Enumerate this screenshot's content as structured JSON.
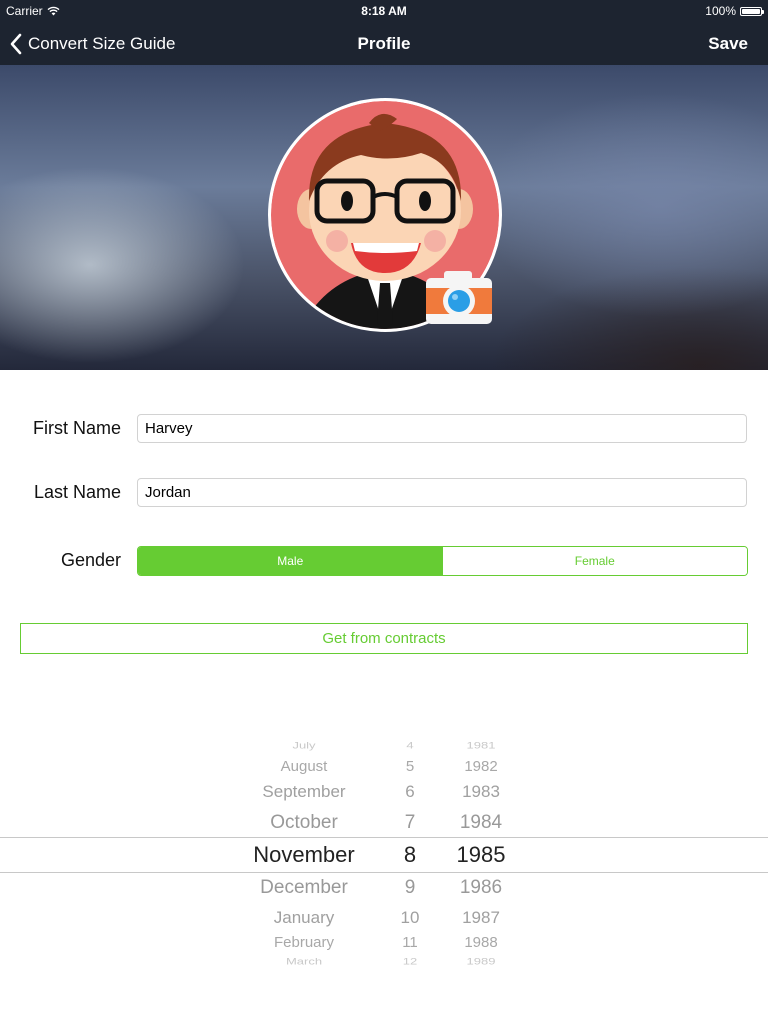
{
  "status_bar": {
    "carrier": "Carrier",
    "time": "8:18 AM",
    "battery": "100%"
  },
  "nav": {
    "back_label": "Convert Size Guide",
    "title": "Profile",
    "save_label": "Save"
  },
  "form": {
    "first_name_label": "First Name",
    "first_name_value": "Harvey",
    "last_name_label": "Last Name",
    "last_name_value": "Jordan",
    "gender_label": "Gender",
    "gender_options": [
      "Male",
      "Female"
    ],
    "gender_selected": "Male"
  },
  "contracts_button": "Get from contracts",
  "date_picker": {
    "months": [
      "July",
      "August",
      "September",
      "October",
      "November",
      "December",
      "January",
      "February",
      "March"
    ],
    "days": [
      "4",
      "5",
      "6",
      "7",
      "8",
      "9",
      "10",
      "11",
      "12"
    ],
    "years": [
      "1981",
      "1982",
      "1983",
      "1984",
      "1985",
      "1986",
      "1987",
      "1988",
      "1989"
    ],
    "selected_month": "November",
    "selected_day": "8",
    "selected_year": "1985"
  },
  "colors": {
    "nav_bg": "#1d2430",
    "accent_green": "#66cc33",
    "avatar_bg": "#e96b6b"
  },
  "icons": {
    "back": "chevron-left-icon",
    "wifi": "wifi-icon",
    "battery": "battery-icon",
    "camera": "camera-icon"
  }
}
